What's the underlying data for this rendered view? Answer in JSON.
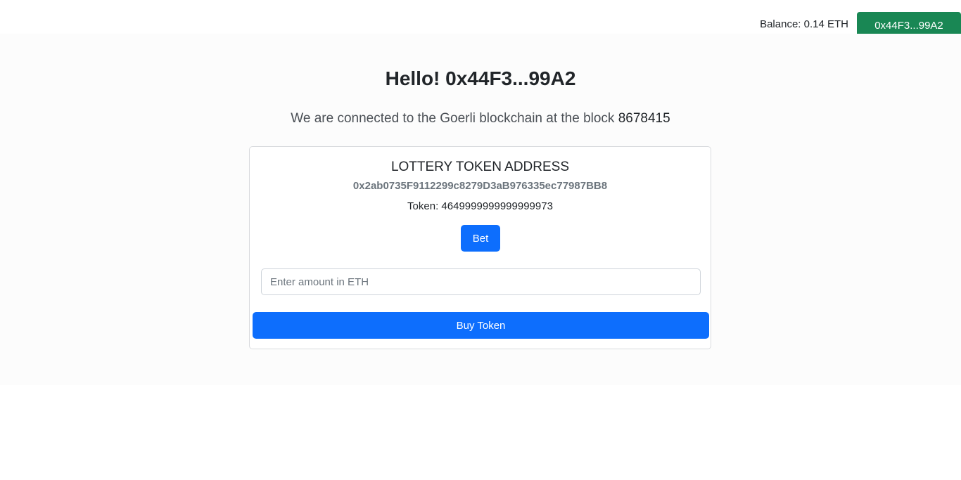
{
  "header": {
    "balance_label": "Balance:",
    "balance_value": "0.14 ETH",
    "wallet_button": "0x44F3...99A2"
  },
  "main": {
    "greeting_prefix": "Hello!",
    "greeting_address": "0x44F3...99A2",
    "connected_text": "We are connected to the Goerli blockchain at the block",
    "block_number": "8678415"
  },
  "card": {
    "title": "LOTTERY TOKEN ADDRESS",
    "address": "0x2ab0735F9112299c8279D3aB976335ec77987BB8",
    "token_label": "Token:",
    "token_value": "4649999999999999973",
    "bet_label": "Bet",
    "amount_placeholder": "Enter amount in ETH",
    "buy_label": "Buy Token"
  },
  "colors": {
    "primary": "#0d6efd",
    "success": "#198754",
    "muted": "#6c757d"
  }
}
